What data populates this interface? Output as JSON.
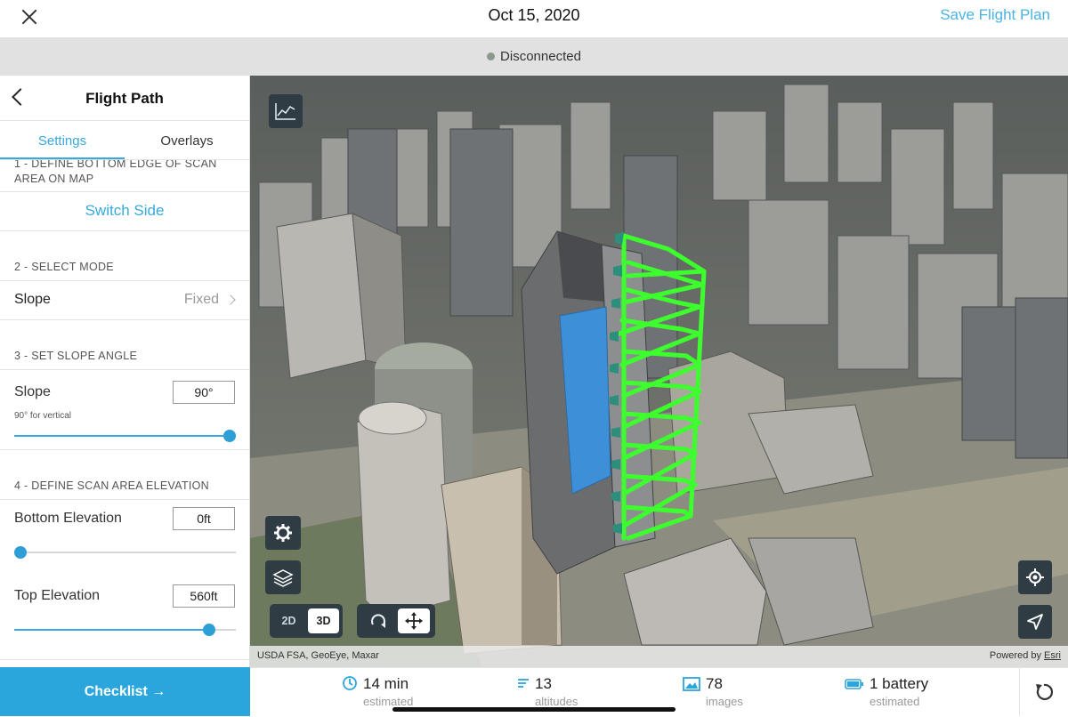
{
  "topbar": {
    "date": "Oct 15, 2020",
    "save_label": "Save Flight Plan"
  },
  "status": {
    "text": "Disconnected",
    "dot_color": "#8b9a8f"
  },
  "panel": {
    "title": "Flight Path",
    "tabs": [
      {
        "label": "Settings",
        "active": true
      },
      {
        "label": "Overlays",
        "active": false
      }
    ],
    "step1_label": "1 - DEFINE BOTTOM EDGE OF SCAN AREA ON MAP",
    "switch_side_label": "Switch Side",
    "step2_label": "2 - SELECT MODE",
    "mode": {
      "label": "Slope",
      "value": "Fixed"
    },
    "step3_label": "3 - SET SLOPE ANGLE",
    "slope": {
      "label": "Slope",
      "value": "90°",
      "hint": "90° for vertical",
      "slider_fraction": 1.0
    },
    "step4_label": "4 - DEFINE SCAN AREA ELEVATION",
    "bottom_elevation": {
      "label": "Bottom Elevation",
      "value": "0ft",
      "slider_fraction": 0.0
    },
    "top_elevation": {
      "label": "Top Elevation",
      "value": "560ft",
      "slider_fraction": 0.88
    },
    "checklist_label": "Checklist →"
  },
  "map": {
    "view_2d_label": "2D",
    "view_3d_label": "3D",
    "selected_view": "3D",
    "attribution_left": "USDA FSA, GeoEye, Maxar",
    "attribution_powered": "Powered by ",
    "attribution_brand": "Esri",
    "flight_path_color": "#3dff2e",
    "facade_highlight_color": "#3d8fd8",
    "icons": {
      "chart": "elevation-chart-icon",
      "settings": "gear-icon",
      "layers": "layers-icon",
      "rotate": "rotate-icon",
      "pan": "move-icon",
      "locate": "crosshair-icon",
      "navigate": "navigation-arrow-icon"
    }
  },
  "stats": [
    {
      "value": "14 min",
      "label": "estimated",
      "icon": "clock-icon"
    },
    {
      "value": "13",
      "label": "altitudes",
      "icon": "altitudes-icon"
    },
    {
      "value": "78",
      "label": "images",
      "icon": "image-icon"
    },
    {
      "value": "1 battery",
      "label": "estimated",
      "icon": "battery-icon"
    }
  ],
  "accent_color": "#2aa6dd"
}
